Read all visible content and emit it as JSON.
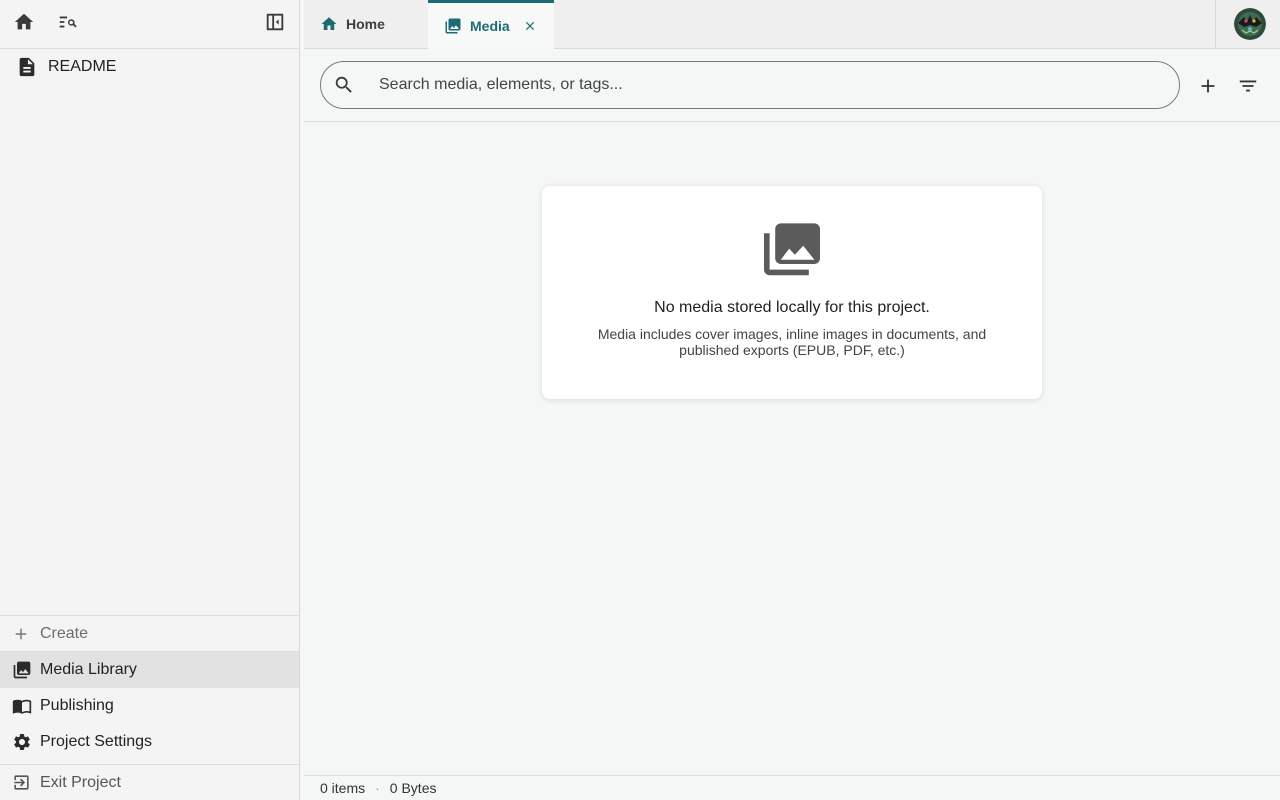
{
  "sidebar": {
    "icons": {
      "home": "home-icon",
      "search": "search-tree-icon",
      "collapse": "collapse-sidebar-icon"
    },
    "tree": [
      {
        "label": "README",
        "icon": "document-icon"
      }
    ],
    "create_label": "Create",
    "nav": [
      {
        "label": "Media Library",
        "icon": "photo-library-icon",
        "active": true
      },
      {
        "label": "Publishing",
        "icon": "book-icon",
        "active": false
      },
      {
        "label": "Project Settings",
        "icon": "gear-icon",
        "active": false
      }
    ],
    "exit_label": "Exit Project"
  },
  "tabs": [
    {
      "label": "Home",
      "icon": "home-icon",
      "active": false
    },
    {
      "label": "Media",
      "icon": "photo-library-icon",
      "active": true,
      "closable": true
    }
  ],
  "toolbar": {
    "search_placeholder": "Search media, elements, or tags...",
    "search_value": "",
    "add_icon": "plus-icon",
    "filter_icon": "filter-icon"
  },
  "empty_state": {
    "icon": "photo-library-icon",
    "title": "No media stored locally for this project.",
    "description": "Media includes cover images, inline images in documents, and published exports (EPUB, PDF, etc.)"
  },
  "status": {
    "items": "0 items",
    "size": "0 Bytes"
  },
  "colors": {
    "accent": "#1e6b73",
    "sidebar_bg": "#f4f4f4",
    "main_bg": "#f5f7f7",
    "active_nav_bg": "#e2e2e2"
  }
}
